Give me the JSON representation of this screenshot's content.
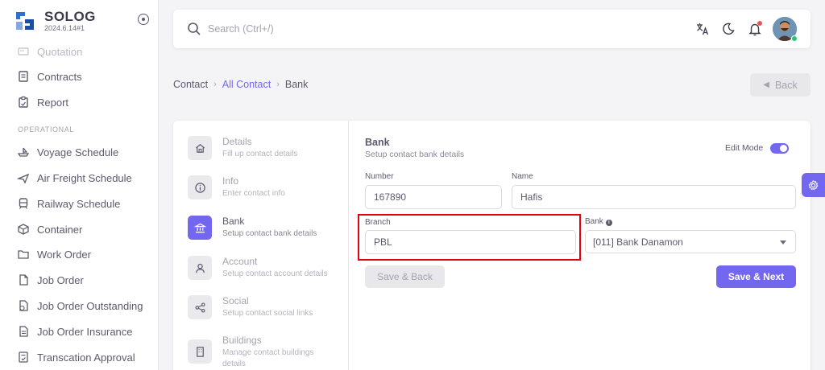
{
  "brand": {
    "name": "SOLOG",
    "version": "2024.6.14#1"
  },
  "sidebar": {
    "section_operational": "OPERATIONAL",
    "items": [
      {
        "label": "Quotation",
        "icon": "quotation-icon"
      },
      {
        "label": "Contracts",
        "icon": "contracts-icon"
      },
      {
        "label": "Report",
        "icon": "report-icon"
      },
      {
        "label": "Voyage Schedule",
        "icon": "ship-icon"
      },
      {
        "label": "Air Freight Schedule",
        "icon": "plane-icon"
      },
      {
        "label": "Railway Schedule",
        "icon": "train-icon"
      },
      {
        "label": "Container",
        "icon": "container-icon"
      },
      {
        "label": "Work Order",
        "icon": "folder-icon"
      },
      {
        "label": "Job Order",
        "icon": "file-icon"
      },
      {
        "label": "Job Order Outstanding",
        "icon": "file-clock-icon"
      },
      {
        "label": "Job Order Insurance",
        "icon": "file-text-icon"
      },
      {
        "label": "Transcation Approval",
        "icon": "approval-icon"
      }
    ]
  },
  "search": {
    "placeholder": "Search (Ctrl+/)"
  },
  "breadcrumb": {
    "root": "Contact",
    "parent": "All Contact",
    "current": "Bank"
  },
  "back_label": "Back",
  "steps": [
    {
      "title": "Details",
      "desc": "Fill up contact details",
      "icon": "home-icon"
    },
    {
      "title": "Info",
      "desc": "Enter contact info",
      "icon": "info-icon"
    },
    {
      "title": "Bank",
      "desc": "Setup contact bank details",
      "icon": "bank-icon"
    },
    {
      "title": "Account",
      "desc": "Setup contact account details",
      "icon": "user-icon"
    },
    {
      "title": "Social",
      "desc": "Setup contact social links",
      "icon": "share-icon"
    },
    {
      "title": "Buildings",
      "desc": "Manage contact buildings details",
      "icon": "building-icon"
    }
  ],
  "form": {
    "title": "Bank",
    "subtitle": "Setup contact bank details",
    "edit_mode_label": "Edit Mode",
    "edit_mode_on": true,
    "number_label": "Number",
    "number_value": "167890",
    "name_label": "Name",
    "name_value": "Hafis",
    "branch_label": "Branch",
    "branch_value": "PBL",
    "bank_label": "Bank",
    "bank_value": "[011] Bank Danamon",
    "save_back_label": "Save & Back",
    "save_next_label": "Save & Next"
  },
  "colors": {
    "primary": "#7367f0",
    "highlight": "#e3000f",
    "online": "#28c76f",
    "notification": "#ea5455"
  }
}
